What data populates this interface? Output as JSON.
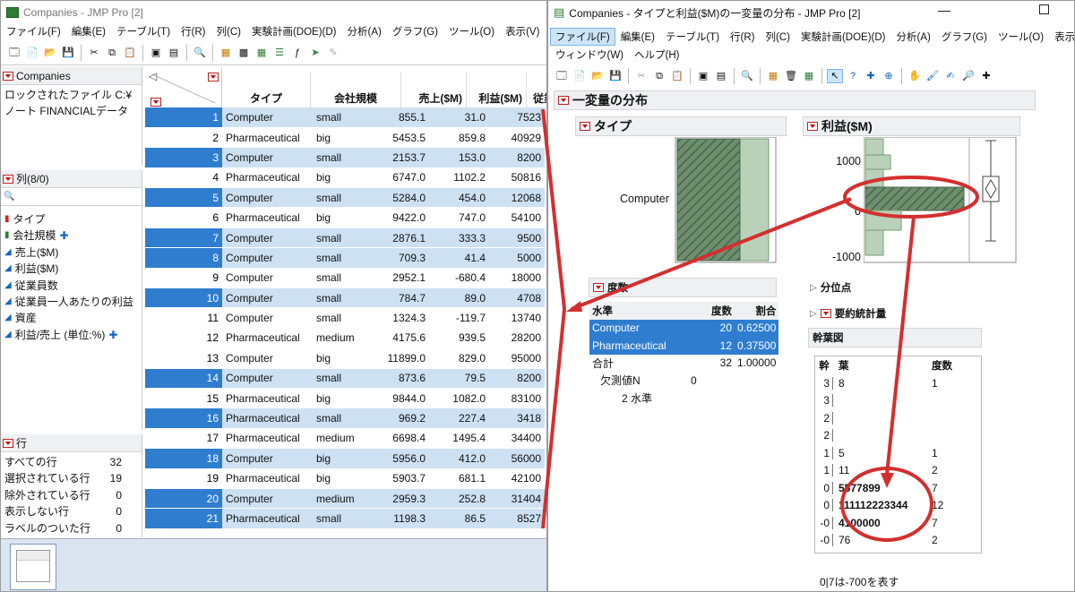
{
  "left_window": {
    "title": "Companies - JMP Pro [2]",
    "menu": [
      "ファイル(F)",
      "編集(E)",
      "テーブル(T)",
      "行(R)",
      "列(C)",
      "実験計画(DOE)(D)",
      "分析(A)",
      "グラフ(G)",
      "ツール(O)",
      "表示(V)"
    ],
    "table_panel": {
      "title": "Companies",
      "lines": [
        "ロックされたファイル C:¥",
        "ノート FINANCIALデータ"
      ]
    },
    "columns_panel": {
      "title": "列(8/0)",
      "items": [
        "タイプ",
        "会社規模",
        "売上($M)",
        "利益($M)",
        "従業員数",
        "従業員一人あたりの利益",
        "資産",
        "利益/売上 (単位:%)"
      ]
    },
    "rows_panel": {
      "title": "行",
      "items": [
        {
          "label": "すべての行",
          "value": "32"
        },
        {
          "label": "選択されている行",
          "value": "19"
        },
        {
          "label": "除外されている行",
          "value": "0"
        },
        {
          "label": "表示しない行",
          "value": "0"
        },
        {
          "label": "ラベルのついた行",
          "value": "0"
        }
      ]
    },
    "headers": [
      "タイプ",
      "会社規模",
      "売上($M)",
      "利益($M)",
      "従業員数"
    ],
    "rows": [
      {
        "n": "1",
        "type": "Computer",
        "size": "small",
        "sales": "855.1",
        "profit": "31.0",
        "emp": "7523",
        "sel": true
      },
      {
        "n": "2",
        "type": "Pharmaceutical",
        "size": "big",
        "sales": "5453.5",
        "profit": "859.8",
        "emp": "40929",
        "sel": false
      },
      {
        "n": "3",
        "type": "Computer",
        "size": "small",
        "sales": "2153.7",
        "profit": "153.0",
        "emp": "8200",
        "sel": true
      },
      {
        "n": "4",
        "type": "Pharmaceutical",
        "size": "big",
        "sales": "6747.0",
        "profit": "1102.2",
        "emp": "50816",
        "sel": false
      },
      {
        "n": "5",
        "type": "Computer",
        "size": "small",
        "sales": "5284.0",
        "profit": "454.0",
        "emp": "12068",
        "sel": true
      },
      {
        "n": "6",
        "type": "Pharmaceutical",
        "size": "big",
        "sales": "9422.0",
        "profit": "747.0",
        "emp": "54100",
        "sel": false
      },
      {
        "n": "7",
        "type": "Computer",
        "size": "small",
        "sales": "2876.1",
        "profit": "333.3",
        "emp": "9500",
        "sel": true
      },
      {
        "n": "8",
        "type": "Computer",
        "size": "small",
        "sales": "709.3",
        "profit": "41.4",
        "emp": "5000",
        "sel": true
      },
      {
        "n": "9",
        "type": "Computer",
        "size": "small",
        "sales": "2952.1",
        "profit": "-680.4",
        "emp": "18000",
        "sel": false
      },
      {
        "n": "10",
        "type": "Computer",
        "size": "small",
        "sales": "784.7",
        "profit": "89.0",
        "emp": "4708",
        "sel": true
      },
      {
        "n": "11",
        "type": "Computer",
        "size": "small",
        "sales": "1324.3",
        "profit": "-119.7",
        "emp": "13740",
        "sel": false
      },
      {
        "n": "12",
        "type": "Pharmaceutical",
        "size": "medium",
        "sales": "4175.6",
        "profit": "939.5",
        "emp": "28200",
        "sel": false
      },
      {
        "n": "13",
        "type": "Computer",
        "size": "big",
        "sales": "11899.0",
        "profit": "829.0",
        "emp": "95000",
        "sel": false
      },
      {
        "n": "14",
        "type": "Computer",
        "size": "small",
        "sales": "873.6",
        "profit": "79.5",
        "emp": "8200",
        "sel": true
      },
      {
        "n": "15",
        "type": "Pharmaceutical",
        "size": "big",
        "sales": "9844.0",
        "profit": "1082.0",
        "emp": "83100",
        "sel": false
      },
      {
        "n": "16",
        "type": "Pharmaceutical",
        "size": "small",
        "sales": "969.2",
        "profit": "227.4",
        "emp": "3418",
        "sel": true
      },
      {
        "n": "17",
        "type": "Pharmaceutical",
        "size": "medium",
        "sales": "6698.4",
        "profit": "1495.4",
        "emp": "34400",
        "sel": false
      },
      {
        "n": "18",
        "type": "Computer",
        "size": "big",
        "sales": "5956.0",
        "profit": "412.0",
        "emp": "56000",
        "sel": true
      },
      {
        "n": "19",
        "type": "Pharmaceutical",
        "size": "big",
        "sales": "5903.7",
        "profit": "681.1",
        "emp": "42100",
        "sel": false
      },
      {
        "n": "20",
        "type": "Computer",
        "size": "medium",
        "sales": "2959.3",
        "profit": "252.8",
        "emp": "31404",
        "sel": true
      },
      {
        "n": "21",
        "type": "Pharmaceutical",
        "size": "small",
        "sales": "1198.3",
        "profit": "86.5",
        "emp": "8527",
        "sel": true
      }
    ]
  },
  "right_window": {
    "title": "Companies - タイプと利益($M)の一変量の分布 - JMP Pro [2]",
    "menu_row1": [
      "ファイル(F)",
      "編集(E)",
      "テーブル(T)",
      "行(R)",
      "列(C)",
      "実験計画(DOE)(D)",
      "分析(A)",
      "グラフ(G)",
      "ツール(O)",
      "表示(V)"
    ],
    "menu_row2": [
      "ウィンドウ(W)",
      "ヘルプ(H)"
    ],
    "report_title": "一変量の分布",
    "type_title": "タイプ",
    "profit_title": "利益($M)",
    "bar_label": "Computer",
    "axis_ticks": [
      "1000",
      "0",
      "-1000"
    ],
    "freq_title": "度数",
    "freq_headers": [
      "水準",
      "度数",
      "割合"
    ],
    "freq_rows": [
      {
        "level": "Computer",
        "count": "20",
        "prop": "0.62500",
        "sel": true
      },
      {
        "level": "Pharmaceutical",
        "count": "12",
        "prop": "0.37500",
        "sel": true
      }
    ],
    "freq_total": {
      "label": "合計",
      "count": "32",
      "prop": "1.00000"
    },
    "freq_missing": {
      "label": "欠測値N",
      "value": "0"
    },
    "freq_levels": "2 水準",
    "quantiles_title": "分位点",
    "summary_title": "要約統計量",
    "stem_title": "幹葉図",
    "stem_headers": [
      "幹",
      "葉",
      "度数"
    ],
    "stem_rows": [
      {
        "stem": "3",
        "leaf": "8",
        "count": "1"
      },
      {
        "stem": "3",
        "leaf": "",
        "count": ""
      },
      {
        "stem": "2",
        "leaf": "",
        "count": ""
      },
      {
        "stem": "2",
        "leaf": "",
        "count": ""
      },
      {
        "stem": "1",
        "leaf": "5",
        "count": "1"
      },
      {
        "stem": "1",
        "leaf": "11",
        "count": "2"
      },
      {
        "stem": "0",
        "leaf": "5577899",
        "count": "7"
      },
      {
        "stem": "0",
        "leaf": "111112223344",
        "count": "12"
      },
      {
        "stem": "-0",
        "leaf": "4100000",
        "count": "7"
      },
      {
        "stem": "-0",
        "leaf": "76",
        "count": "2"
      }
    ],
    "stem_note": "0|7は-700を表す"
  },
  "colors": {
    "accent": "#2f7dcf",
    "selected_row": "#cde1f3",
    "annotation": "#d32f2f",
    "hist_fill": "#5e8a5e"
  }
}
